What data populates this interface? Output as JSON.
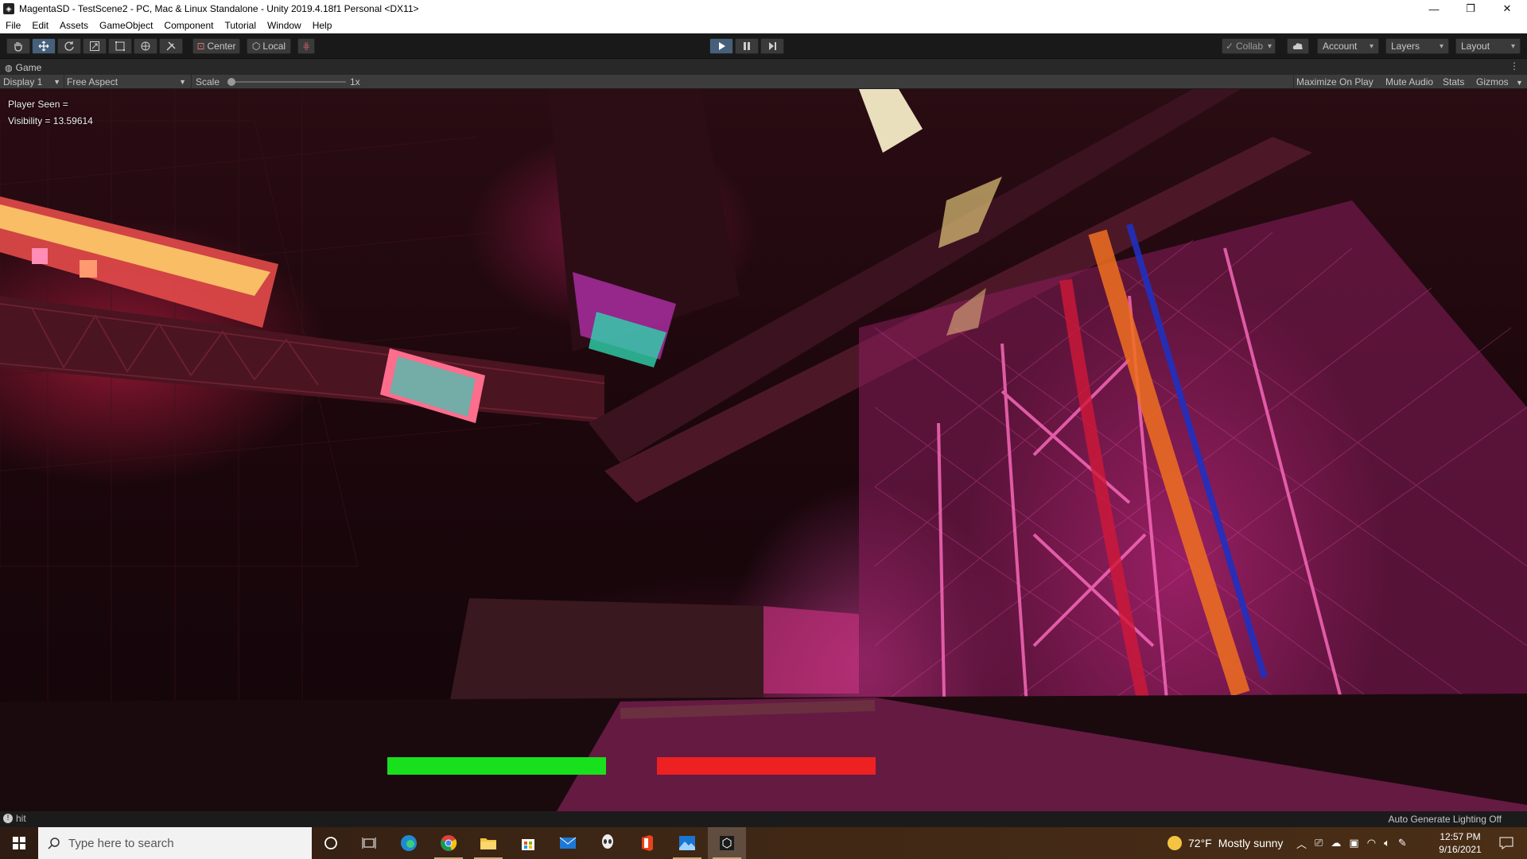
{
  "window": {
    "title": "MagentaSD - TestScene2 - PC, Mac & Linux Standalone - Unity 2019.4.18f1 Personal <DX11>",
    "minimize": "—",
    "restore": "❐",
    "close": "✕"
  },
  "menu": [
    "File",
    "Edit",
    "Assets",
    "GameObject",
    "Component",
    "Tutorial",
    "Window",
    "Help"
  ],
  "toolbar": {
    "tools": [
      "hand-tool",
      "move-tool",
      "rotate-tool",
      "scale-tool",
      "rect-tool",
      "transform-tool",
      "custom-tool"
    ],
    "pivot_label": "Center",
    "space_label": "Local",
    "collab_label": "Collab",
    "account_label": "Account",
    "layers_label": "Layers",
    "layout_label": "Layout",
    "play_active": true
  },
  "game_tab": {
    "label": "Game"
  },
  "game_bar": {
    "display": "Display 1",
    "aspect": "Free Aspect",
    "scale_label": "Scale",
    "scale_value": "1x",
    "maximize": "Maximize On Play",
    "mute": "Mute Audio",
    "stats": "Stats",
    "gizmos": "Gizmos"
  },
  "hud": {
    "player_seen": "Player Seen =",
    "visibility": "Visibility = 13.59614",
    "health_bar_color": "#19e01d",
    "detection_bar_color": "#ed2121"
  },
  "status": {
    "message": "hit",
    "lighting": "Auto Generate Lighting Off"
  },
  "taskbar": {
    "search_placeholder": "Type here to search",
    "weather_temp": "72°F",
    "weather_text": "Mostly sunny",
    "time": "12:57 PM",
    "date": "9/16/2021"
  }
}
